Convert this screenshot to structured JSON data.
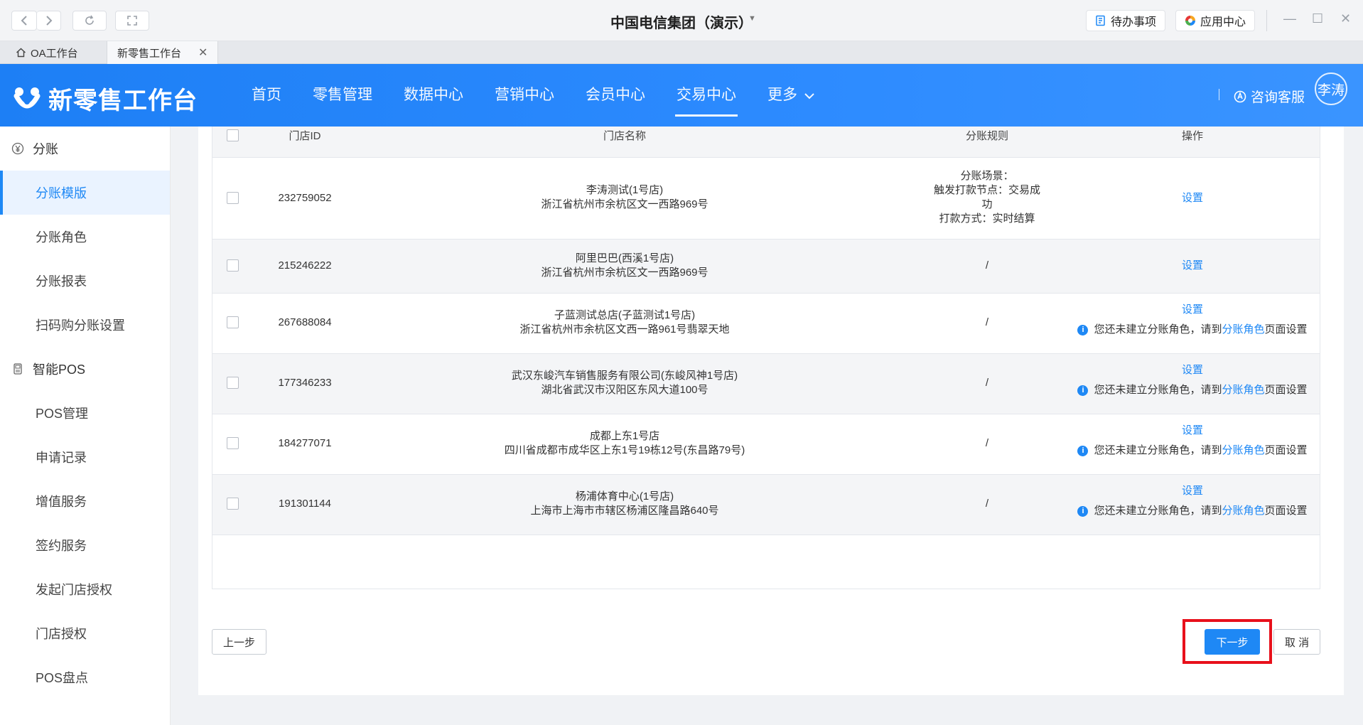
{
  "window": {
    "title": "中国电信集团（演示）",
    "todo_label": "待办事项",
    "app_center_label": "应用中心"
  },
  "tabs": [
    {
      "label": "OA工作台"
    },
    {
      "label": "新零售工作台"
    }
  ],
  "app": {
    "name": "新零售工作台",
    "nav": [
      "首页",
      "零售管理",
      "数据中心",
      "营销中心",
      "会员中心",
      "交易中心",
      "更多"
    ],
    "active_nav": "交易中心",
    "support_label": "咨询客服",
    "user_name": "李涛",
    "accent_color": "#1e88f5"
  },
  "sidebar": {
    "groups": [
      {
        "label": "分账",
        "icon": "yen-circle-icon",
        "items": [
          "分账模版",
          "分账角色",
          "分账报表",
          "扫码购分账设置"
        ]
      },
      {
        "label": "智能POS",
        "icon": "pos-device-icon",
        "items": [
          "POS管理",
          "申请记录",
          "增值服务",
          "签约服务",
          "发起门店授权",
          "门店授权",
          "POS盘点"
        ]
      }
    ],
    "active_item": "分账模版"
  },
  "table": {
    "columns": [
      "门店ID",
      "门店名称",
      "分账规则",
      "操作"
    ],
    "rows": [
      {
        "id": "232759052",
        "name": "李涛测试(1号店)",
        "address": "浙江省杭州市余杭区文一西路969号",
        "rule": [
          "分账场景：",
          "触发打款节点：交易成",
          "功",
          "打款方式：实时结算"
        ],
        "action": "设置",
        "warning": null
      },
      {
        "id": "215246222",
        "name": "阿里巴巴(西溪1号店)",
        "address": "浙江省杭州市余杭区文一西路969号",
        "rule": [
          "/"
        ],
        "action": "设置",
        "warning": null
      },
      {
        "id": "267688084",
        "name": "子蓝测试总店(子蓝测试1号店)",
        "address": "浙江省杭州市余杭区文西一路961号翡翠天地",
        "rule": [
          "/"
        ],
        "action": "设置",
        "warning": {
          "before": "您还未建立分账角色，请到",
          "link": "分账角色",
          "after": "页面设置"
        }
      },
      {
        "id": "177346233",
        "name": "武汉东峻汽车销售服务有限公司(东峻风神1号店)",
        "address": "湖北省武汉市汉阳区东风大道100号",
        "rule": [
          "/"
        ],
        "action": "设置",
        "warning": {
          "before": "您还未建立分账角色，请到",
          "link": "分账角色",
          "after": "页面设置"
        }
      },
      {
        "id": "184277071",
        "name": "成都上东1号店",
        "address": "四川省成都市成华区上东1号19栋12号(东昌路79号)",
        "rule": [
          "/"
        ],
        "action": "设置",
        "warning": {
          "before": "您还未建立分账角色，请到",
          "link": "分账角色",
          "after": "页面设置"
        }
      },
      {
        "id": "191301144",
        "name": "杨浦体育中心(1号店)",
        "address": "上海市上海市市辖区杨浦区隆昌路640号",
        "rule": [
          "/"
        ],
        "action": "设置",
        "warning": {
          "before": "您还未建立分账角色，请到",
          "link": "分账角色",
          "after": "页面设置"
        }
      }
    ]
  },
  "footer": {
    "prev_label": "上一步",
    "next_label": "下一步",
    "cancel_label": "取 消"
  }
}
